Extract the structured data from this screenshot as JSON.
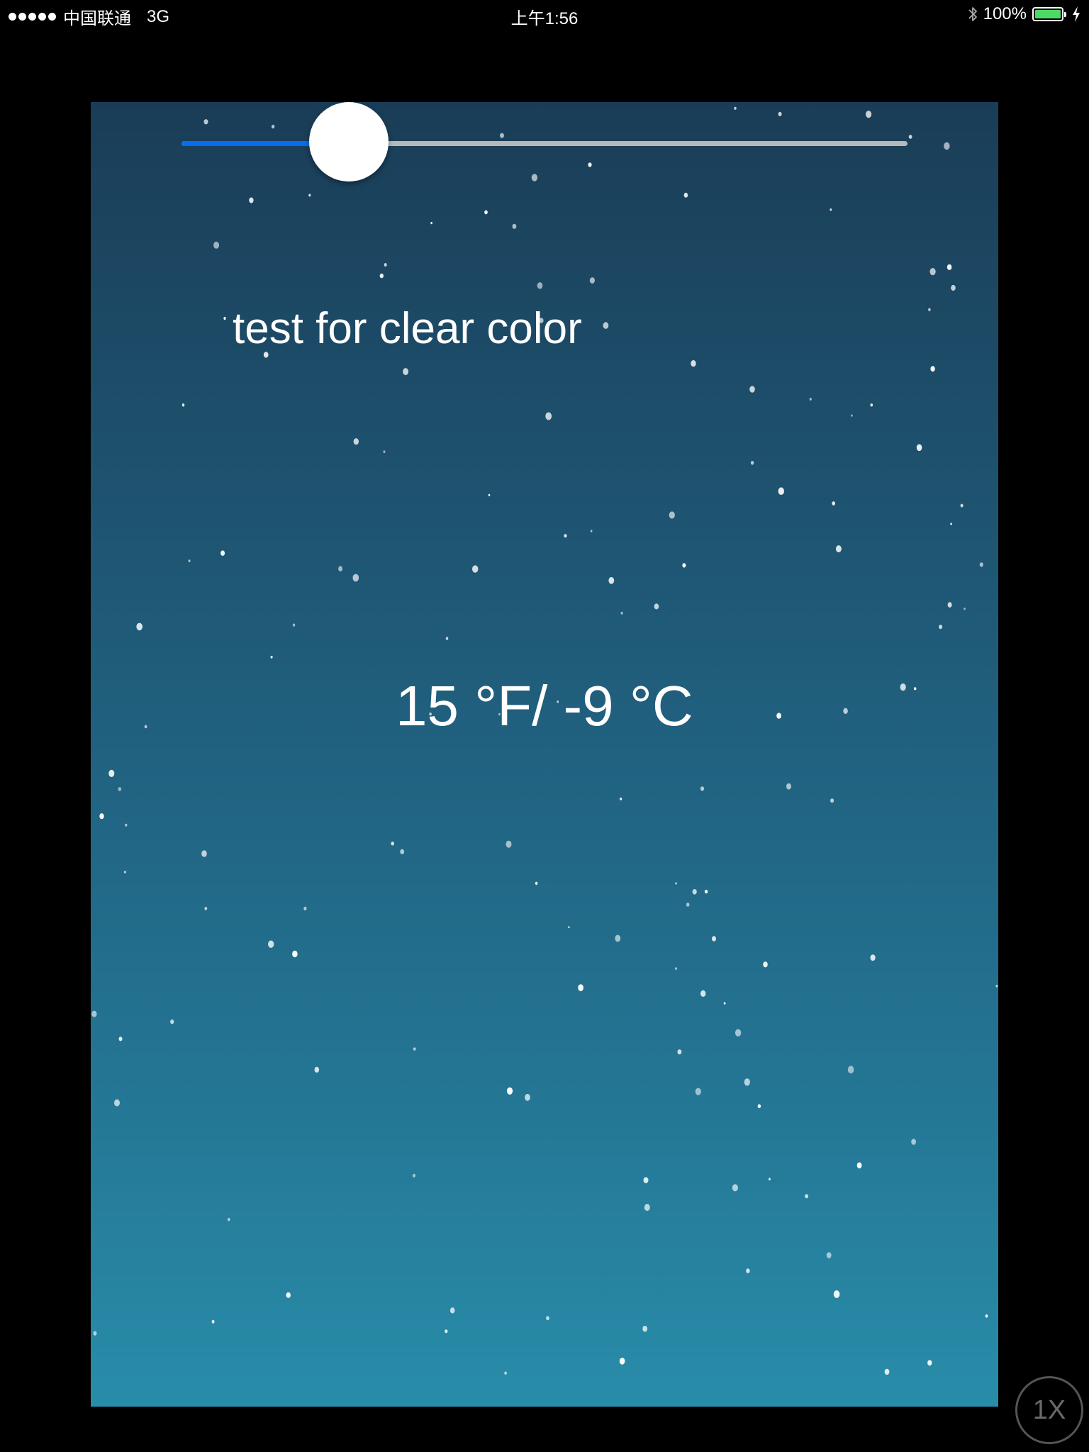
{
  "status_bar": {
    "carrier": "中国联通",
    "network": "3G",
    "time": "上午1:56",
    "battery_percent": "100%",
    "battery_level": 1.0,
    "icons": [
      "signal-dots-icon",
      "bluetooth-icon",
      "battery-icon",
      "charging-bolt-icon"
    ]
  },
  "slider": {
    "value": 0.23
  },
  "caption": "test for clear color",
  "temperature": "15 °F/ -9 °C",
  "speed_button": {
    "label": "1X"
  },
  "colors": {
    "slider_accent": "#0a6cf0",
    "battery": "#4cd964",
    "background_top": "#1a3d57",
    "background_bottom": "#288da9"
  }
}
